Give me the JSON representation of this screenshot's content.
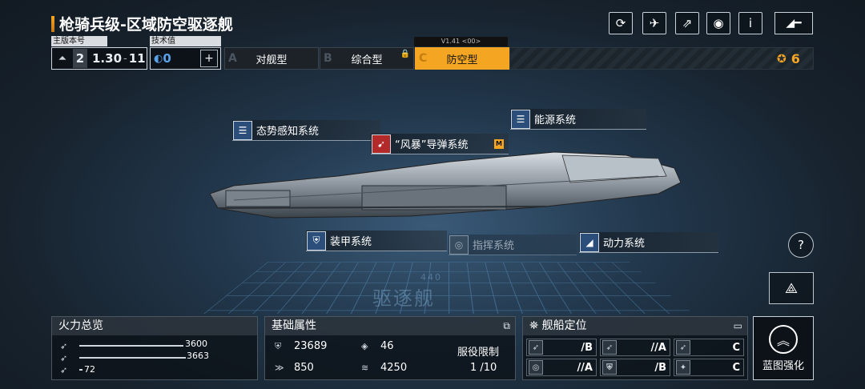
{
  "title": "枪骑兵级-区域防空驱逐舰",
  "version": {
    "label": "主版本号",
    "main": "2",
    "sub": "1.30",
    "sub2": "11"
  },
  "tech": {
    "label": "技术值",
    "value": "0"
  },
  "tabs": [
    {
      "letter": "A",
      "label": "对舰型",
      "active": false,
      "locked": false
    },
    {
      "letter": "B",
      "label": "综合型",
      "active": false,
      "locked": true
    },
    {
      "letter": "C",
      "label": "防空型",
      "active": true,
      "locked": false
    }
  ],
  "version_flag": "V1.41 <00>",
  "rank": "6",
  "systems": {
    "situational": "态势感知系统",
    "energy": "能源系统",
    "missile": "“风暴”导弹系统",
    "missile_tag": "M",
    "armor": "装甲系统",
    "command": "指挥系统",
    "power": "动力系统"
  },
  "emblem_text": "驱逐舰",
  "emblem_num": "440",
  "firepower": {
    "title": "火力总览",
    "rows": [
      {
        "value": "3600",
        "fraction": 0.93
      },
      {
        "value": "3663",
        "fraction": 0.95
      },
      {
        "value": "72",
        "fraction": 0.02
      }
    ]
  },
  "base_stats": {
    "title": "基础属性",
    "hp": "23689",
    "armor": "46",
    "speed": "850",
    "energy": "4250",
    "service_label": "服役限制",
    "service_value": "1 /10"
  },
  "positioning": {
    "title": "舰船定位",
    "grades": [
      "/B",
      "//A",
      "C",
      "//A",
      "/B",
      "C"
    ]
  },
  "blueprint_label": "蓝图强化",
  "colors": {
    "accent": "#f4a623",
    "panel": "#0c1218",
    "system_icon": "#2b4f7a"
  }
}
